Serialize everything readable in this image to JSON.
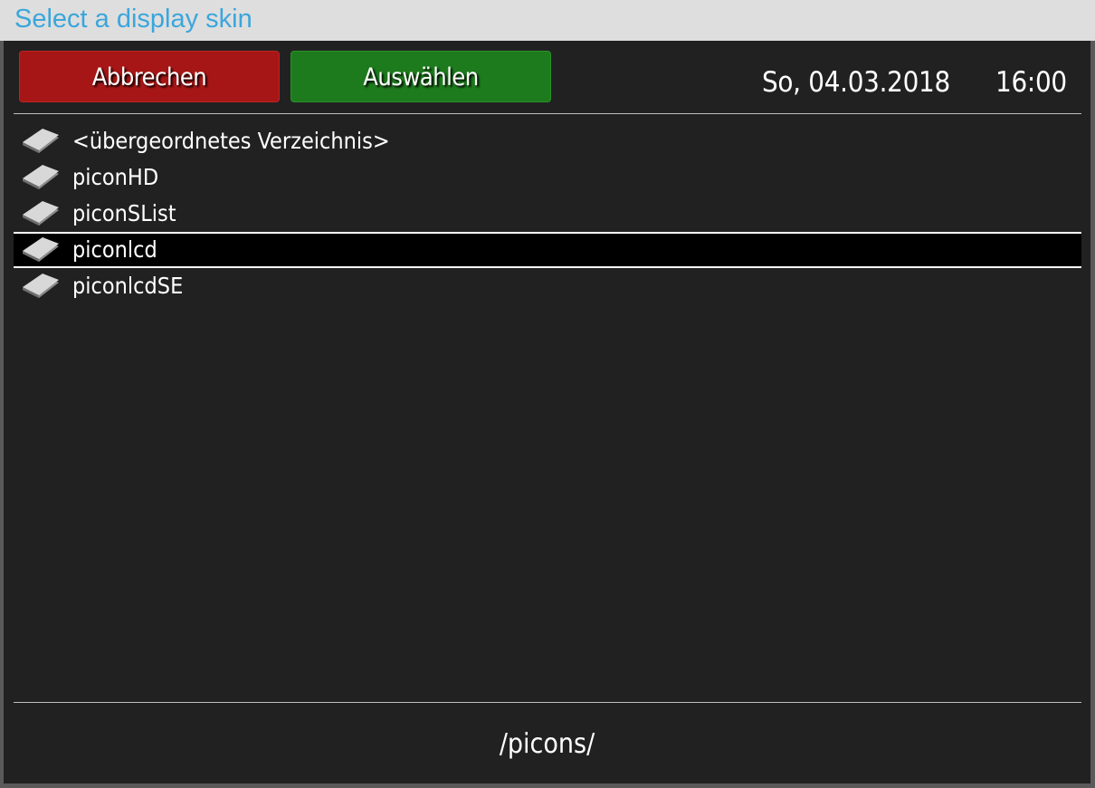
{
  "window": {
    "title": "Select a display skin"
  },
  "buttons": {
    "cancel_label": "Abbrechen",
    "select_label": "Auswählen"
  },
  "clock": {
    "date": "So, 04.03.2018",
    "time": "16:00"
  },
  "file_list": {
    "items": [
      {
        "label": "<übergeordnetes Verzeichnis>",
        "icon": "folder-icon",
        "selected": false
      },
      {
        "label": "piconHD",
        "icon": "folder-icon",
        "selected": false
      },
      {
        "label": "piconSList",
        "icon": "folder-icon",
        "selected": false
      },
      {
        "label": "piconlcd",
        "icon": "folder-icon",
        "selected": true
      },
      {
        "label": "piconlcdSE",
        "icon": "folder-icon",
        "selected": false
      }
    ]
  },
  "current_path": "/picons/",
  "colors": {
    "title": "#3aa6dc",
    "cancel_button": "#a71616",
    "select_button": "#1d7a1d",
    "background": "#212121",
    "selection_background": "#000000"
  }
}
